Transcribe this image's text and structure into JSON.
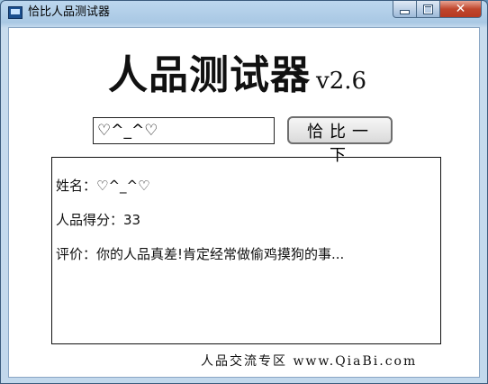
{
  "window": {
    "title": "恰比人品测试器",
    "close_glyph": "✕"
  },
  "app": {
    "heading": "人品测试器",
    "version": "v2.6"
  },
  "input": {
    "value": "♡^_^♡"
  },
  "button": {
    "label": "恰比一下"
  },
  "result": {
    "name_line": "姓名：♡^_^♡",
    "score_line": "人品得分：33",
    "comment_line": "评价：你的人品真差!肯定经常做偷鸡摸狗的事..."
  },
  "footer": {
    "text": "人品交流专区 www.QiaBi.com"
  }
}
